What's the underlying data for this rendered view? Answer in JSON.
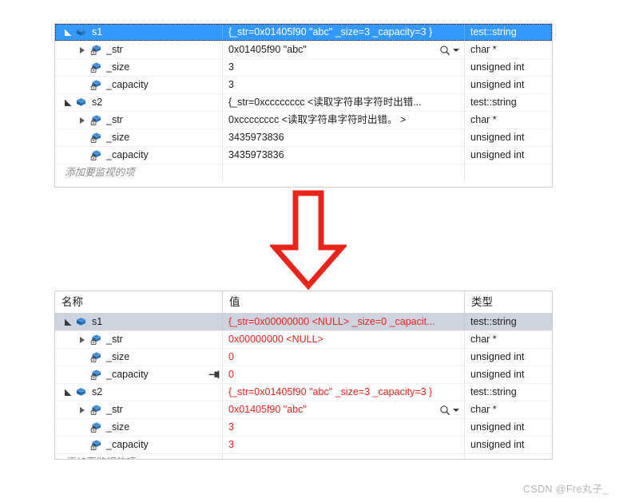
{
  "watermark": "CSDN @Fre丸子_",
  "colors": {
    "selection_active": "#3399ff",
    "selection_inactive": "#cdd3df",
    "value_changed": "#e8241b",
    "arrow": "#e8241b",
    "text": "#1e1e1e"
  },
  "arrow": {
    "name": "down-arrow",
    "direction": "down"
  },
  "panels": [
    {
      "id": "watch-panel-before",
      "show_header": false,
      "headers": {
        "name": "名称",
        "value": "值",
        "type": "类型"
      },
      "add_watch_placeholder": "添加要监视的项",
      "rows": [
        {
          "name": "s1",
          "value": "{_str=0x01405f90 \"abc\" _size=3 _capacity=3 }",
          "type": "test::string",
          "indent": 0,
          "expander": "open",
          "icon": "object-cube-icon",
          "selection": "active",
          "focus_ring": true,
          "value_state": "normal",
          "visualizer": false,
          "pin": false
        },
        {
          "name": "_str",
          "value": "0x01405f90 \"abc\"",
          "type": "char *",
          "indent": 1,
          "expander": "closed",
          "icon": "private-member-icon",
          "selection": "none",
          "focus_ring": false,
          "value_state": "normal",
          "visualizer": true,
          "pin": false
        },
        {
          "name": "_size",
          "value": "3",
          "type": "unsigned int",
          "indent": 1,
          "expander": "none",
          "icon": "private-member-icon",
          "selection": "none",
          "focus_ring": false,
          "value_state": "normal",
          "visualizer": false,
          "pin": false
        },
        {
          "name": "_capacity",
          "value": "3",
          "type": "unsigned int",
          "indent": 1,
          "expander": "none",
          "icon": "private-member-icon",
          "selection": "none",
          "focus_ring": false,
          "value_state": "normal",
          "visualizer": false,
          "pin": false
        },
        {
          "name": "s2",
          "value": "{_str=0xcccccccc <读取字符串字符时出错...",
          "type": "test::string",
          "indent": 0,
          "expander": "open",
          "icon": "object-cube-icon",
          "selection": "none",
          "focus_ring": false,
          "value_state": "normal",
          "visualizer": false,
          "pin": false
        },
        {
          "name": "_str",
          "value": "0xcccccccc <读取字符串字符时出错。 >",
          "type": "char *",
          "indent": 1,
          "expander": "closed",
          "icon": "private-member-icon",
          "selection": "none",
          "focus_ring": false,
          "value_state": "normal",
          "visualizer": false,
          "pin": false
        },
        {
          "name": "_size",
          "value": "3435973836",
          "type": "unsigned int",
          "indent": 1,
          "expander": "none",
          "icon": "private-member-icon",
          "selection": "none",
          "focus_ring": false,
          "value_state": "normal",
          "visualizer": false,
          "pin": false
        },
        {
          "name": "_capacity",
          "value": "3435973836",
          "type": "unsigned int",
          "indent": 1,
          "expander": "none",
          "icon": "private-member-icon",
          "selection": "none",
          "focus_ring": false,
          "value_state": "normal",
          "visualizer": false,
          "pin": false
        }
      ]
    },
    {
      "id": "watch-panel-after",
      "show_header": true,
      "headers": {
        "name": "名称",
        "value": "值",
        "type": "类型"
      },
      "add_watch_placeholder": "添加要监视的项",
      "rows": [
        {
          "name": "s1",
          "value": "{_str=0x00000000 <NULL> _size=0 _capacit...",
          "type": "test::string",
          "indent": 0,
          "expander": "open",
          "icon": "object-cube-icon",
          "selection": "inactive",
          "focus_ring": false,
          "value_state": "changed",
          "visualizer": false,
          "pin": false
        },
        {
          "name": "_str",
          "value": "0x00000000 <NULL>",
          "type": "char *",
          "indent": 1,
          "expander": "closed",
          "icon": "private-member-icon",
          "selection": "none",
          "focus_ring": false,
          "value_state": "changed",
          "visualizer": false,
          "pin": false
        },
        {
          "name": "_size",
          "value": "0",
          "type": "unsigned int",
          "indent": 1,
          "expander": "none",
          "icon": "private-member-icon",
          "selection": "none",
          "focus_ring": false,
          "value_state": "changed",
          "visualizer": false,
          "pin": false
        },
        {
          "name": "_capacity",
          "value": "0",
          "type": "unsigned int",
          "indent": 1,
          "expander": "none",
          "icon": "private-member-icon",
          "selection": "none",
          "focus_ring": false,
          "value_state": "changed",
          "visualizer": false,
          "pin": true
        },
        {
          "name": "s2",
          "value": "{_str=0x01405f90 \"abc\" _size=3 _capacity=3 }",
          "type": "test::string",
          "indent": 0,
          "expander": "open",
          "icon": "object-cube-icon",
          "selection": "none",
          "focus_ring": false,
          "value_state": "changed",
          "visualizer": false,
          "pin": false
        },
        {
          "name": "_str",
          "value": "0x01405f90 \"abc\"",
          "type": "char *",
          "indent": 1,
          "expander": "closed",
          "icon": "private-member-icon",
          "selection": "none",
          "focus_ring": false,
          "value_state": "changed",
          "visualizer": true,
          "pin": false
        },
        {
          "name": "_size",
          "value": "3",
          "type": "unsigned int",
          "indent": 1,
          "expander": "none",
          "icon": "private-member-icon",
          "selection": "none",
          "focus_ring": false,
          "value_state": "changed",
          "visualizer": false,
          "pin": false
        },
        {
          "name": "_capacity",
          "value": "3",
          "type": "unsigned int",
          "indent": 1,
          "expander": "none",
          "icon": "private-member-icon",
          "selection": "none",
          "focus_ring": false,
          "value_state": "changed",
          "visualizer": false,
          "pin": false
        }
      ]
    }
  ]
}
